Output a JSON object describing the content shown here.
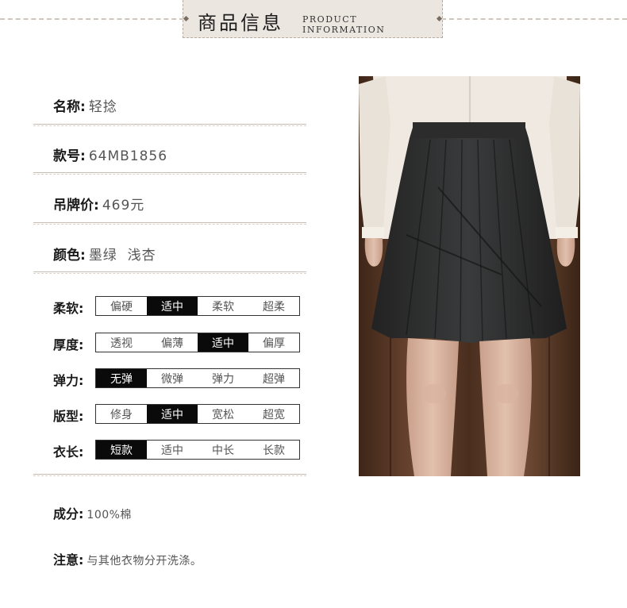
{
  "header": {
    "title": "商品信息",
    "subtitle": "PRODUCT INFORMATION"
  },
  "info": {
    "name": {
      "label": "名称:",
      "value": "轻捻"
    },
    "style_no": {
      "label": "款号:",
      "value": "64MB1856"
    },
    "price": {
      "label": "吊牌价:",
      "value": "469元"
    },
    "color": {
      "label": "颜色:",
      "value": "墨绿  浅杏"
    }
  },
  "scales": [
    {
      "label": "柔软:",
      "options": [
        "偏硬",
        "适中",
        "柔软",
        "超柔"
      ],
      "selected": 1
    },
    {
      "label": "厚度:",
      "options": [
        "透视",
        "偏薄",
        "适中",
        "偏厚"
      ],
      "selected": 2
    },
    {
      "label": "弹力:",
      "options": [
        "无弹",
        "微弹",
        "弹力",
        "超弹"
      ],
      "selected": 0
    },
    {
      "label": "版型:",
      "options": [
        "修身",
        "适中",
        "宽松",
        "超宽"
      ],
      "selected": 1
    },
    {
      "label": "衣长:",
      "options": [
        "短款",
        "适中",
        "中长",
        "长款"
      ],
      "selected": 0
    }
  ],
  "composition": {
    "label": "成分:",
    "value": "100%棉"
  },
  "note": {
    "label": "注意:",
    "value": "与其他衣物分开洗涤。"
  },
  "colors": {
    "selected_fill": "#0a0a0a",
    "banner_bg": "#ece6e0",
    "photo_wall": "#5a3a26"
  }
}
